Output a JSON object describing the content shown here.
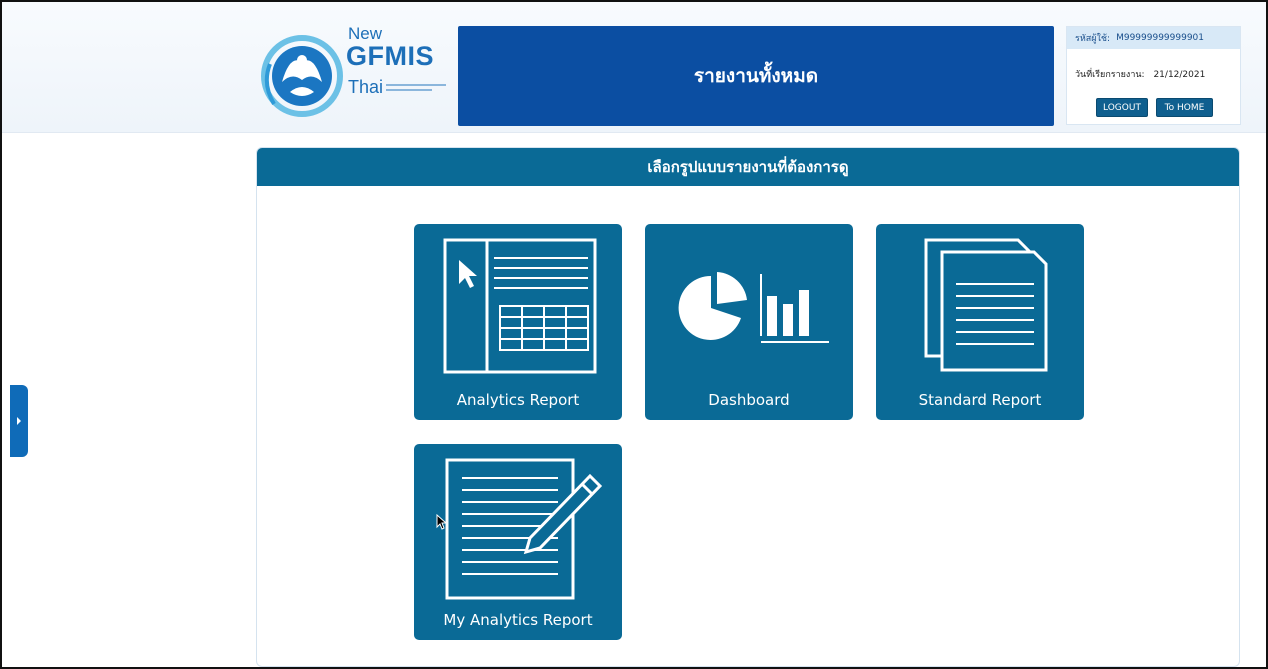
{
  "header": {
    "logo": {
      "line1": "New",
      "line2": "GFMIS",
      "line3": "Thai"
    },
    "title": "รายงานทั้งหมด",
    "user": {
      "id_label": "รหัสผู้ใช้:",
      "id_value": "M99999999999901",
      "date_label": "วันที่เรียกรายงาน:",
      "date_value": "21/12/2021",
      "logout_label": "LOGOUT",
      "home_label": "To HOME"
    }
  },
  "panel": {
    "heading": "เลือกรูปแบบรายงานที่ต้องการดู",
    "tiles": [
      {
        "label": "Analytics Report",
        "icon": "analytics-report-icon"
      },
      {
        "label": "Dashboard",
        "icon": "dashboard-icon"
      },
      {
        "label": "Standard Report",
        "icon": "standard-report-icon"
      },
      {
        "label": "My Analytics Report",
        "icon": "my-analytics-report-icon"
      }
    ]
  },
  "colors": {
    "banner": "#0b4ea2",
    "tile": "#0a6a96",
    "panel_header": "#0a6a96",
    "side_tab": "#0f6bb8"
  }
}
